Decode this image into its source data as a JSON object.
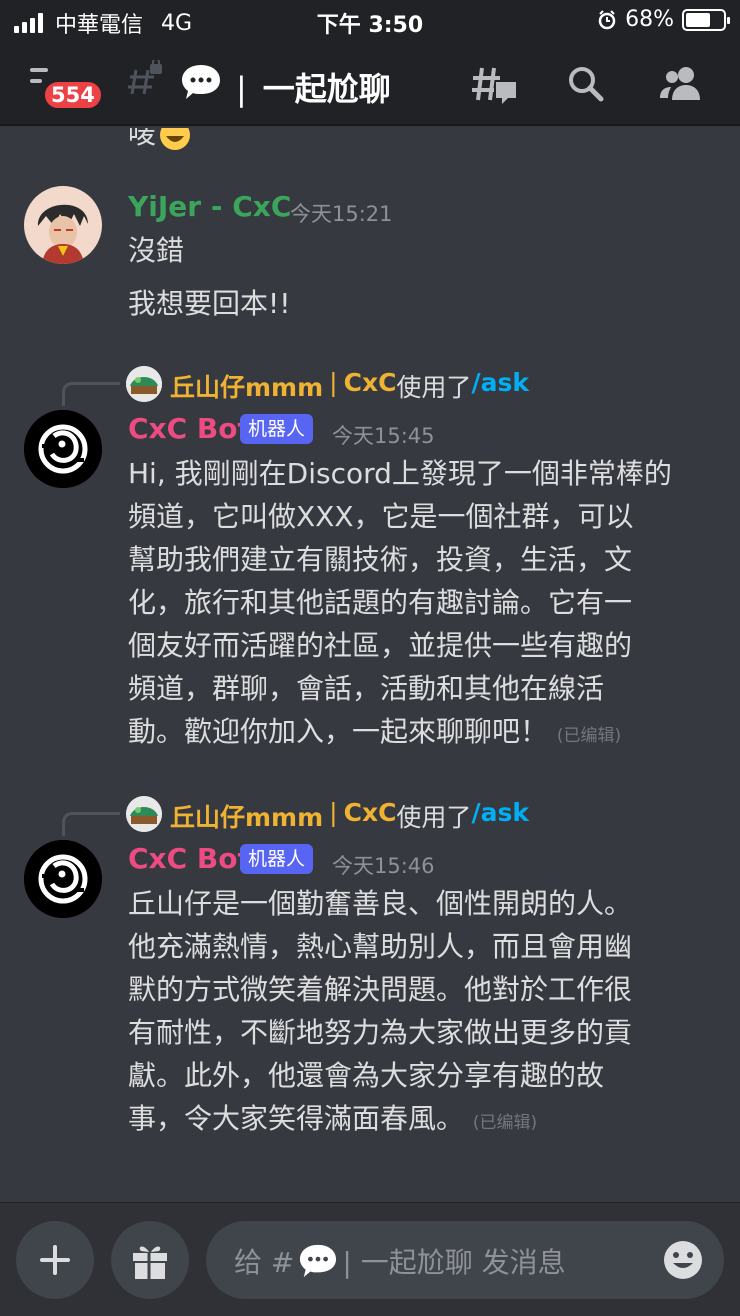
{
  "status_bar": {
    "carrier": "中華電信",
    "network": "4G",
    "time": "下午 3:50",
    "battery_percent": "68%",
    "battery_level": 0.68
  },
  "header": {
    "unread_badge": "554",
    "channel_name": "一起尬聊",
    "icons": [
      "menu-icon",
      "hash-lock-icon",
      "speech-bubble-emoji",
      "threads-icon",
      "search-icon",
      "members-icon"
    ]
  },
  "messages": {
    "partial_text": "唛",
    "m1": {
      "username": "YiJer - CxC",
      "username_color": "#3ba55c",
      "timestamp": "今天15:21",
      "lines": [
        "沒錯",
        "我想要回本!!"
      ]
    },
    "m2": {
      "reply_user": "丘山仔mmm",
      "reply_sep": "|",
      "reply_server": "CxC",
      "reply_used": "使用了",
      "reply_command": "/ask",
      "username": "CxC Bot",
      "username_color": "#ed4b82",
      "bot_tag": "机器人",
      "timestamp": "今天15:45",
      "lines": [
        "Hi, 我剛剛在Discord上發現了一個非常棒的",
        "頻道，它叫做XXX，它是一個社群，可以",
        "幫助我們建立有關技術，投資，生活，文",
        "化，旅行和其他話題的有趣討論。它有一",
        "個友好而活躍的社區，並提供一些有趣的",
        "頻道，群聊，會話，活動和其他在線活",
        "動。歡迎你加入，一起來聊聊吧！"
      ],
      "edited": "(已编辑)"
    },
    "m3": {
      "reply_user": "丘山仔mmm",
      "reply_sep": "|",
      "reply_server": "CxC",
      "reply_used": "使用了",
      "reply_command": "/ask",
      "username": "CxC Bot",
      "username_color": "#ed4b82",
      "bot_tag": "机器人",
      "timestamp": "今天15:46",
      "lines": [
        "丘山仔是一個勤奮善良、個性開朗的人。",
        "他充滿熱情，熱心幫助別人，而且會用幽",
        "默的方式微笑着解決問題。他對於工作很",
        "有耐性，不斷地努力為大家做出更多的貢",
        "獻。此外，他還會為大家分享有趣的故",
        "事，令大家笑得滿面春風。"
      ],
      "edited": "(已编辑)"
    }
  },
  "input": {
    "placeholder_prefix": "给 #",
    "placeholder_channel": "| 一起尬聊 发消息",
    "icons": [
      "plus-icon",
      "gift-icon",
      "emoji-icon"
    ]
  }
}
